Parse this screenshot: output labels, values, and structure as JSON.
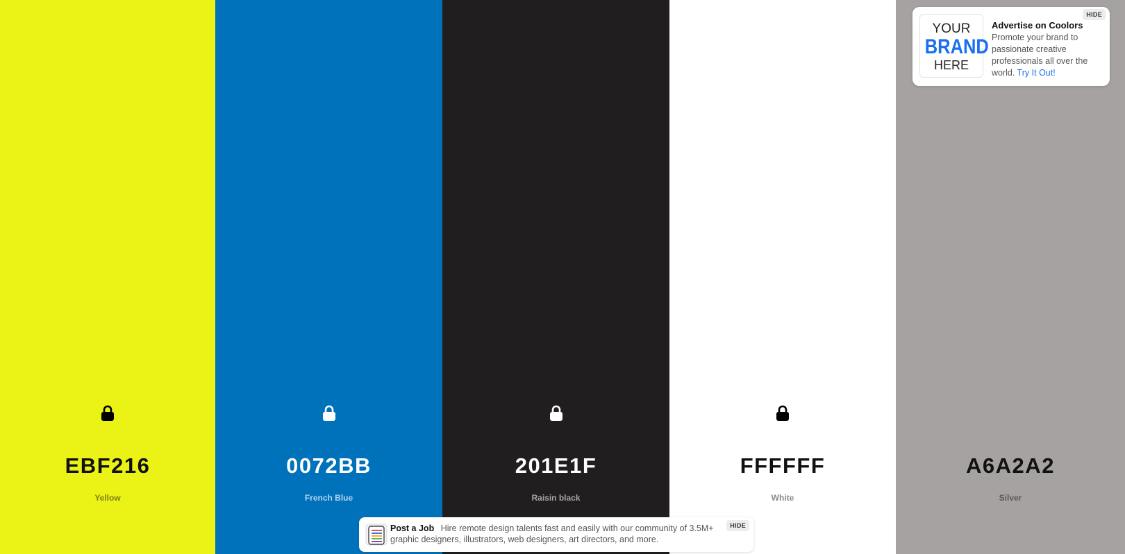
{
  "palette": {
    "colors": [
      {
        "hex": "EBF216",
        "name": "Yellow",
        "bg": "#EBF216",
        "fg": "#111111",
        "lock_color": "#000000",
        "locked": true
      },
      {
        "hex": "0072BB",
        "name": "French Blue",
        "bg": "#0072BB",
        "fg": "#FFFFFF",
        "lock_color": "#FFFFFF",
        "locked": true
      },
      {
        "hex": "201E1F",
        "name": "Raisin black",
        "bg": "#201E1F",
        "fg": "#FFFFFF",
        "lock_color": "#FFFFFF",
        "locked": true
      },
      {
        "hex": "FFFFFF",
        "name": "White",
        "bg": "#FFFFFF",
        "fg": "#111111",
        "lock_color": "#000000",
        "locked": true
      },
      {
        "hex": "A6A2A2",
        "name": "Silver",
        "bg": "#A6A2A2",
        "fg": "#111111",
        "lock_color": "#000000",
        "locked": false
      }
    ]
  },
  "ad": {
    "logo_line1": "YOUR",
    "logo_line2": "BRAND",
    "logo_line3": "HERE",
    "title": "Advertise on Coolors",
    "description": "Promote your brand to passionate creative professionals all over the world.",
    "link": "Try It Out!",
    "hide_label": "HIDE"
  },
  "job_banner": {
    "title": "Post a Job",
    "description": "Hire remote design talents fast and easily with our community of 3.5M+ graphic designers, illustrators, web designers, art directors, and more.",
    "hide_label": "HIDE"
  },
  "icons": {
    "lock": "lock-icon",
    "job_thumb": "job-board-icon"
  }
}
